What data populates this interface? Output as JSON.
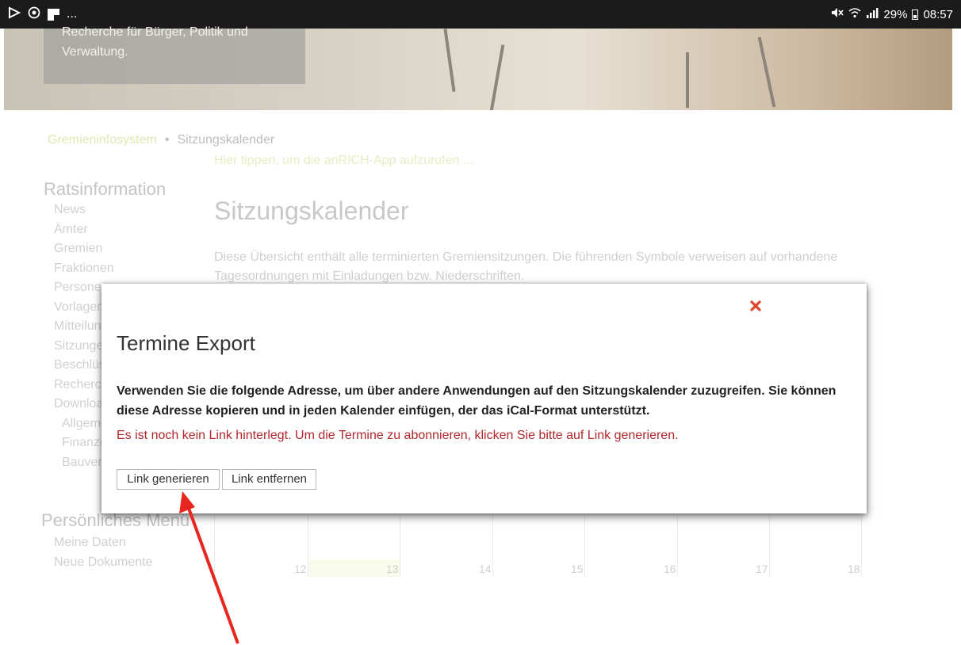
{
  "status_bar": {
    "left_extra": "...",
    "battery": "29%",
    "time": "08:57"
  },
  "hero": {
    "line1": "Recherche für Bürger, Politik und",
    "line2": "Verwaltung."
  },
  "breadcrumb": {
    "root": "Gremieninfosystem",
    "separator": "•",
    "current": "Sitzungskalender"
  },
  "app_link": "Hier tippen, um die anRICH-App aufzurufen ...",
  "sidebar": {
    "title": "Ratsinformation",
    "items": [
      {
        "label": "News"
      },
      {
        "label": "Ämter"
      },
      {
        "label": "Gremien"
      },
      {
        "label": "Fraktionen"
      },
      {
        "label": "Personen"
      },
      {
        "label": "Vorlagen"
      },
      {
        "label": "Mitteilungen"
      },
      {
        "label": "Sitzungen"
      },
      {
        "label": "Beschlüsse"
      },
      {
        "label": "Recherche"
      },
      {
        "label": "Downloads"
      }
    ],
    "sub_items": [
      {
        "label": "Allgemein"
      },
      {
        "label": "Finanzen"
      },
      {
        "label": "Bauverwaltung"
      }
    ]
  },
  "personal_menu": {
    "title": "Persönliches Menü",
    "items": [
      {
        "label": "Meine Daten"
      },
      {
        "label": "Neue Dokumente"
      }
    ]
  },
  "main": {
    "title": "Sitzungskalender",
    "intro": "Diese Übersicht enthält alle terminierten Gremiensitzungen. Die führenden Symbole verweisen auf vorhandene Tagesordnungen mit Einladungen bzw. Niederschriften."
  },
  "calendar": {
    "days": [
      "12",
      "13",
      "14",
      "15",
      "16",
      "17",
      "18"
    ],
    "highlighted_day": "13"
  },
  "modal": {
    "title": "Termine Export",
    "close_icon": "close-x",
    "description": "Verwenden Sie die folgende Adresse, um über andere Anwendungen auf den Sitzungskalender zuzugreifen. Sie können diese Adresse kopieren und in jeden Kalender einfügen, der das iCal-Format unterstützt.",
    "warning": "Es ist noch kein Link hinterlegt. Um die Termine zu abonnieren, klicken Sie bitte auf Link generieren.",
    "buttons": {
      "generate": "Link generieren",
      "remove": "Link entfernen"
    }
  },
  "colors": {
    "warning_text": "#b1272c",
    "close_icon": "#d9462c",
    "annotation_arrow": "#e8251f",
    "status_bar_bg": "#1b1b1b"
  }
}
